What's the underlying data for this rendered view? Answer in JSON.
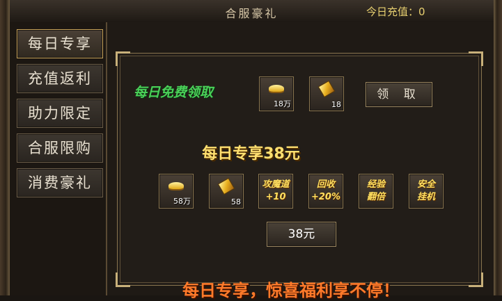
{
  "header": {
    "title": "合服豪礼",
    "recharge_label": "今日充值：",
    "recharge_value": "0"
  },
  "sidebar": {
    "items": [
      {
        "label": "每日专享",
        "active": true
      },
      {
        "label": "充值返利",
        "active": false
      },
      {
        "label": "助力限定",
        "active": false
      },
      {
        "label": "合服限购",
        "active": false
      },
      {
        "label": "消费豪礼",
        "active": false
      }
    ]
  },
  "free": {
    "label": "每日免费领取",
    "items": [
      {
        "icon": "gold-ingot-icon",
        "qty": "18万"
      },
      {
        "icon": "gold-gem-icon",
        "qty": "18"
      }
    ],
    "claim_label": "领 取"
  },
  "package": {
    "title": "每日专享38元",
    "items": [
      {
        "icon": "gold-ingot-icon",
        "qty": "58万"
      },
      {
        "icon": "gold-gem-icon",
        "qty": "58"
      },
      {
        "line1": "攻魔道",
        "line2": "+10"
      },
      {
        "line1": "回收",
        "line2": "+20%"
      },
      {
        "line1": "经验",
        "line2": "翻倍"
      },
      {
        "line1": "安全",
        "line2": "挂机"
      }
    ],
    "price_label": "38元"
  },
  "promo": "每日专享，惊喜福利享不停！",
  "colors": {
    "accent_gold": "#ffe070",
    "free_green": "#4ad058",
    "promo_orange": "#ff7a2a"
  }
}
